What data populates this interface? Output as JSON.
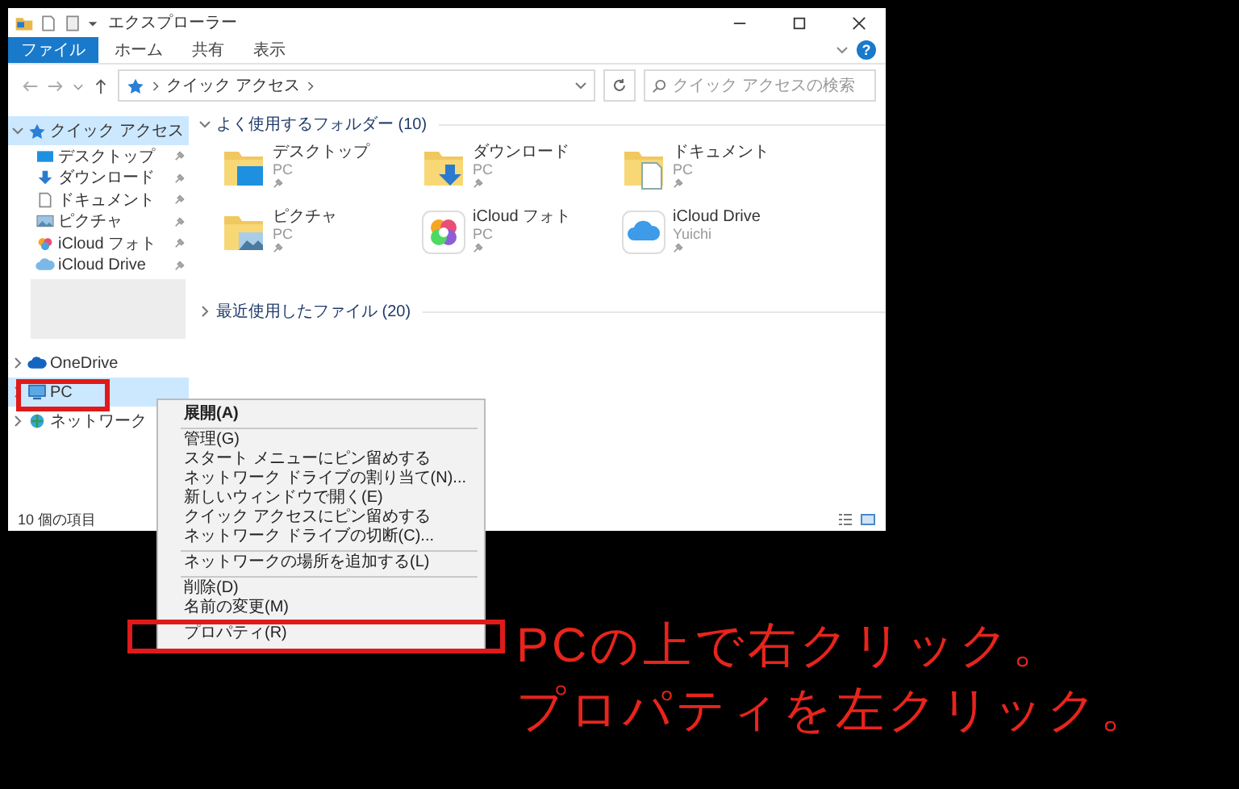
{
  "window": {
    "title": "エクスプローラー"
  },
  "ribbon": {
    "tabs": [
      {
        "label": "ファイル",
        "selected": true
      },
      {
        "label": "ホーム",
        "selected": false
      },
      {
        "label": "共有",
        "selected": false
      },
      {
        "label": "表示",
        "selected": false
      }
    ],
    "help": "?"
  },
  "address_bar": {
    "location": "クイック アクセス"
  },
  "search": {
    "placeholder": "クイック アクセスの検索"
  },
  "sidebar": {
    "items": [
      {
        "label": "クイック アクセス",
        "kind": "star",
        "selected": true,
        "expanded": true,
        "children": [
          {
            "label": "デスクトップ",
            "kind": "desktop",
            "pinned": true
          },
          {
            "label": "ダウンロード",
            "kind": "downloads",
            "pinned": true
          },
          {
            "label": "ドキュメント",
            "kind": "documents",
            "pinned": true
          },
          {
            "label": "ピクチャ",
            "kind": "pictures",
            "pinned": true
          },
          {
            "label": "iCloud フォト",
            "kind": "photos",
            "pinned": true
          },
          {
            "label": "iCloud Drive",
            "kind": "cloud",
            "pinned": true
          }
        ]
      },
      {
        "label": "OneDrive",
        "kind": "onedrive",
        "selected": false,
        "expanded": false
      },
      {
        "label": "PC",
        "kind": "pc",
        "selected": true,
        "expanded": false
      },
      {
        "label": "ネットワーク",
        "kind": "network",
        "selected": false,
        "expanded": false
      }
    ]
  },
  "groups": [
    {
      "title": "よく使用するフォルダー (10)",
      "expanded": true,
      "items": [
        {
          "name": "デスクトップ",
          "location": "PC",
          "pinned": true,
          "kind": "desktop"
        },
        {
          "name": "ダウンロード",
          "location": "PC",
          "pinned": true,
          "kind": "downloads"
        },
        {
          "name": "ドキュメント",
          "location": "PC",
          "pinned": true,
          "kind": "documents"
        },
        {
          "name": "ピクチャ",
          "location": "PC",
          "pinned": true,
          "kind": "pictures"
        },
        {
          "name": "iCloud フォト",
          "location": "PC",
          "pinned": true,
          "kind": "photos"
        },
        {
          "name": "iCloud Drive",
          "location": "Yuichi",
          "pinned": true,
          "kind": "cloud"
        }
      ]
    },
    {
      "title": "最近使用したファイル (20)",
      "expanded": false
    }
  ],
  "status_bar": {
    "item_count": "10 個の項目"
  },
  "context_menu": {
    "groups": [
      [
        {
          "label": "展開(A)",
          "default": true
        }
      ],
      [
        {
          "label": "管理(G)",
          "default": false
        },
        {
          "label": "スタート メニューにピン留めする",
          "default": false
        },
        {
          "label": "ネットワーク ドライブの割り当て(N)...",
          "default": false
        },
        {
          "label": "新しいウィンドウで開く(E)",
          "default": false
        },
        {
          "label": "クイック アクセスにピン留めする",
          "default": false
        },
        {
          "label": "ネットワーク ドライブの切断(C)...",
          "default": false
        }
      ],
      [
        {
          "label": "ネットワークの場所を追加する(L)",
          "default": false
        }
      ],
      [
        {
          "label": "削除(D)",
          "default": false
        },
        {
          "label": "名前の変更(M)",
          "default": false
        }
      ],
      [
        {
          "label": "プロパティ(R)",
          "default": false
        }
      ]
    ]
  },
  "annotation": {
    "lines": [
      "PCの上で右クリック。",
      "プロパティを左クリック。"
    ]
  }
}
